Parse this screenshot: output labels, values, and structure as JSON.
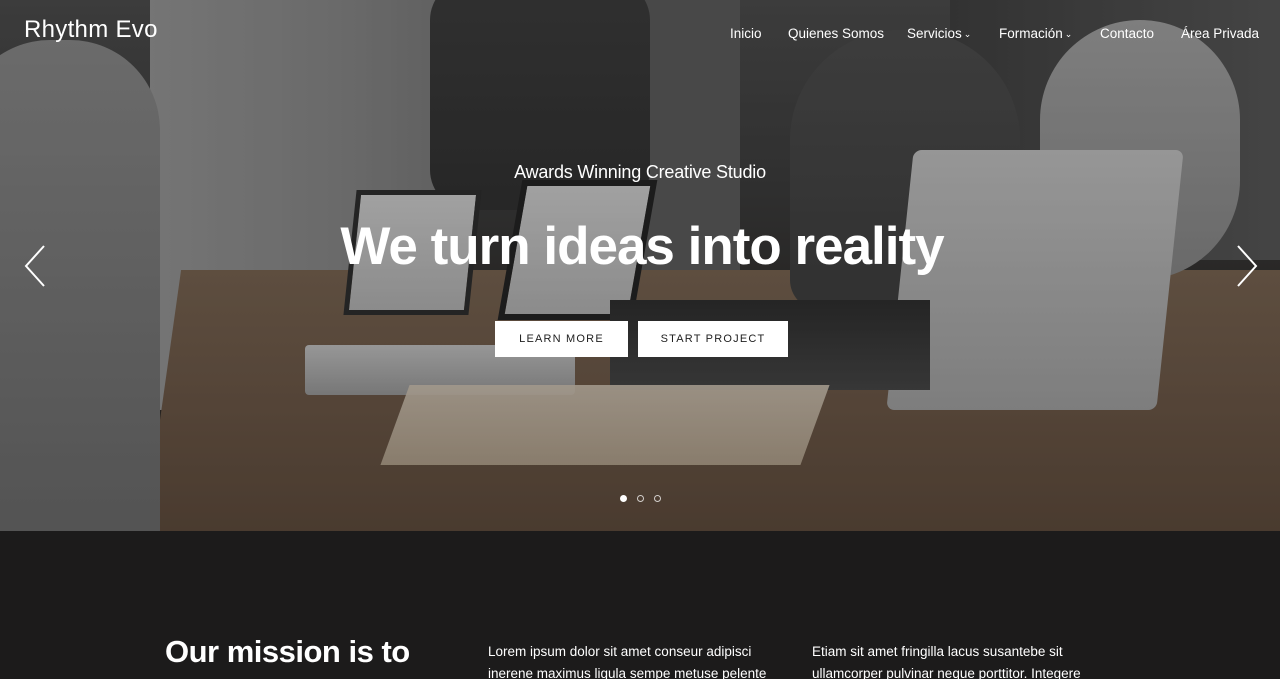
{
  "header": {
    "brand": "Rhythm Evo",
    "nav": [
      {
        "label": "Inicio",
        "has_dropdown": false
      },
      {
        "label": "Quienes Somos",
        "has_dropdown": false
      },
      {
        "label": "Servicios",
        "has_dropdown": true
      },
      {
        "label": "Formación",
        "has_dropdown": true
      },
      {
        "label": "Contacto",
        "has_dropdown": false
      },
      {
        "label": "Área Privada",
        "has_dropdown": false
      }
    ]
  },
  "hero": {
    "subtitle": "Awards Winning Creative Studio",
    "title": "We turn ideas into reality",
    "buttons": {
      "learn_more": "LEARN MORE",
      "start_project": "START PROJECT"
    },
    "slides": {
      "total": 3,
      "active": 1
    },
    "icons": {
      "prev": "chevron-left-icon",
      "next": "chevron-right-icon"
    }
  },
  "mission": {
    "title": "Our mission is to",
    "columns": [
      "Lorem ipsum dolor sit amet conseur adipisci inerene maximus ligula sempe metuse pelente",
      "Etiam sit amet fringilla lacus susantebe sit ullamcorper pulvinar neque porttitor. Integere"
    ]
  },
  "colors": {
    "section_bg": "#1c1b1b",
    "text_light": "#ffffff",
    "button_bg": "#ffffff",
    "button_text": "#1e1e1e"
  }
}
